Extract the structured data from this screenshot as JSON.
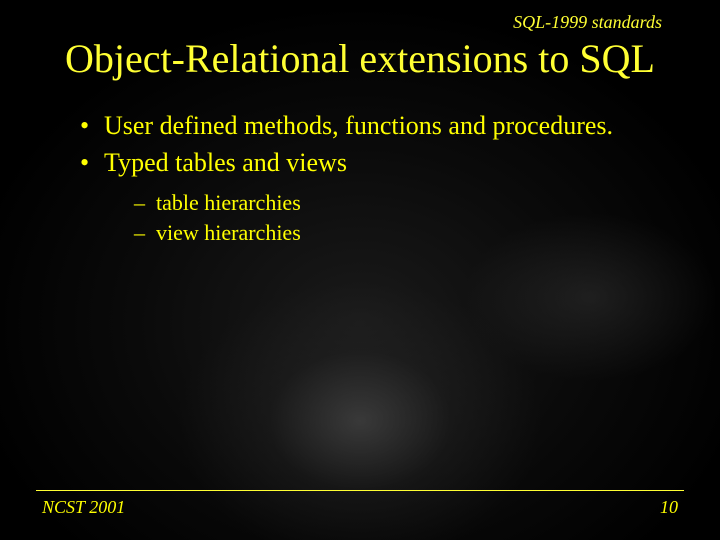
{
  "header": {
    "overline": "SQL-1999 standards",
    "title": "Object-Relational extensions to SQL"
  },
  "bullets": [
    {
      "text": "User defined methods, functions and procedures."
    },
    {
      "text": "Typed tables and views",
      "sub": [
        {
          "text": "table hierarchies"
        },
        {
          "text": "view hierarchies"
        }
      ]
    }
  ],
  "footer": {
    "left": "NCST 2001",
    "right": "10"
  }
}
